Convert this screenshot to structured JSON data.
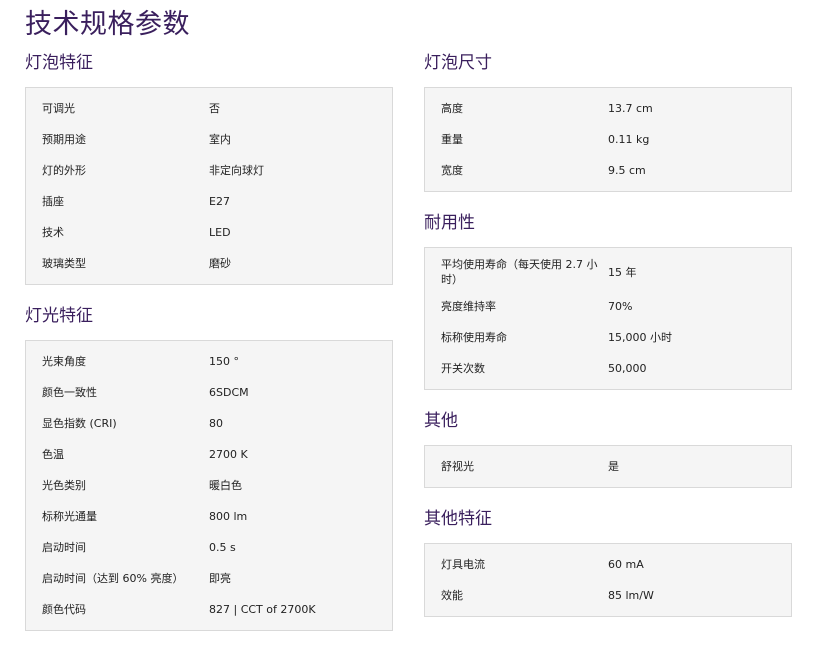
{
  "page_title": "技术规格参数",
  "left_sections": [
    {
      "title": "灯泡特征",
      "rows": [
        {
          "label": "可调光",
          "value": "否"
        },
        {
          "label": "预期用途",
          "value": "室内"
        },
        {
          "label": "灯的外形",
          "value": "非定向球灯"
        },
        {
          "label": "插座",
          "value": "E27"
        },
        {
          "label": "技术",
          "value": "LED"
        },
        {
          "label": "玻璃类型",
          "value": "磨砂"
        }
      ]
    },
    {
      "title": "灯光特征",
      "rows": [
        {
          "label": "光束角度",
          "value": "150 °"
        },
        {
          "label": "颜色一致性",
          "value": "6SDCM"
        },
        {
          "label": "显色指数 (CRI)",
          "value": "80"
        },
        {
          "label": "色温",
          "value": "2700 K"
        },
        {
          "label": "光色类别",
          "value": "暖白色"
        },
        {
          "label": "标称光通量",
          "value": "800 lm"
        },
        {
          "label": "启动时间",
          "value": "0.5 s"
        },
        {
          "label": "启动时间（达到 60% 亮度）",
          "value": "即亮"
        },
        {
          "label": "颜色代码",
          "value": "827 | CCT of 2700K"
        }
      ]
    }
  ],
  "right_sections": [
    {
      "title": "灯泡尺寸",
      "rows": [
        {
          "label": "高度",
          "value": "13.7 cm"
        },
        {
          "label": "重量",
          "value": "0.11 kg"
        },
        {
          "label": "宽度",
          "value": "9.5 cm"
        }
      ]
    },
    {
      "title": "耐用性",
      "rows": [
        {
          "label": "平均使用寿命（每天使用 2.7 小时）",
          "value": "15 年"
        },
        {
          "label": "亮度维持率",
          "value": "70%"
        },
        {
          "label": "标称使用寿命",
          "value": "15,000 小时"
        },
        {
          "label": "开关次数",
          "value": "50,000"
        }
      ]
    },
    {
      "title": "其他",
      "rows": [
        {
          "label": "舒视光",
          "value": "是"
        }
      ]
    },
    {
      "title": "其他特征",
      "rows": [
        {
          "label": "灯具电流",
          "value": "60 mA"
        },
        {
          "label": "效能",
          "value": "85 lm/W"
        }
      ]
    }
  ]
}
